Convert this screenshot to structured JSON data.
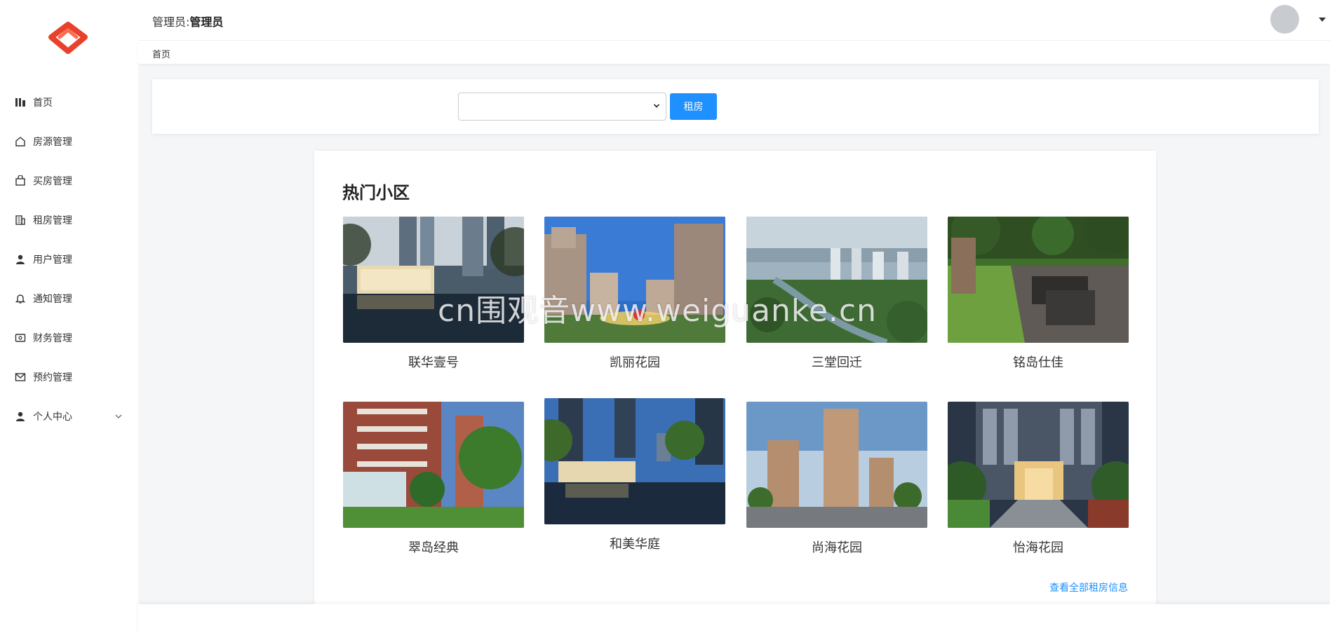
{
  "brand": {
    "accent": "#e8412c",
    "primary": "#1e90ff"
  },
  "sidebar": {
    "items": [
      {
        "label": "首页",
        "icon": "dashboard-icon"
      },
      {
        "label": "房源管理",
        "icon": "house-icon"
      },
      {
        "label": "买房管理",
        "icon": "shopping-bag-icon"
      },
      {
        "label": "租房管理",
        "icon": "building-icon"
      },
      {
        "label": "用户管理",
        "icon": "user-icon"
      },
      {
        "label": "通知管理",
        "icon": "bell-icon"
      },
      {
        "label": "财务管理",
        "icon": "wallet-icon"
      },
      {
        "label": "预约管理",
        "icon": "mail-icon"
      },
      {
        "label": "个人中心",
        "icon": "user-icon"
      }
    ]
  },
  "header": {
    "admin_prefix": "管理员:",
    "admin_name": "管理员"
  },
  "breadcrumb": {
    "home": "首页"
  },
  "search": {
    "selected": "",
    "button": "租房"
  },
  "main": {
    "section_title": "热门小区",
    "communities": [
      {
        "name": "联华壹号"
      },
      {
        "name": "凯丽花园"
      },
      {
        "name": "三堂回迁"
      },
      {
        "name": "铭岛仕佳"
      },
      {
        "name": "翠岛经典"
      },
      {
        "name": "和美华庭"
      },
      {
        "name": "尚海花园"
      },
      {
        "name": "怡海花园"
      }
    ],
    "view_all": "查看全部租房信息"
  },
  "watermark": "cn围观音www.weiguanke.cn"
}
